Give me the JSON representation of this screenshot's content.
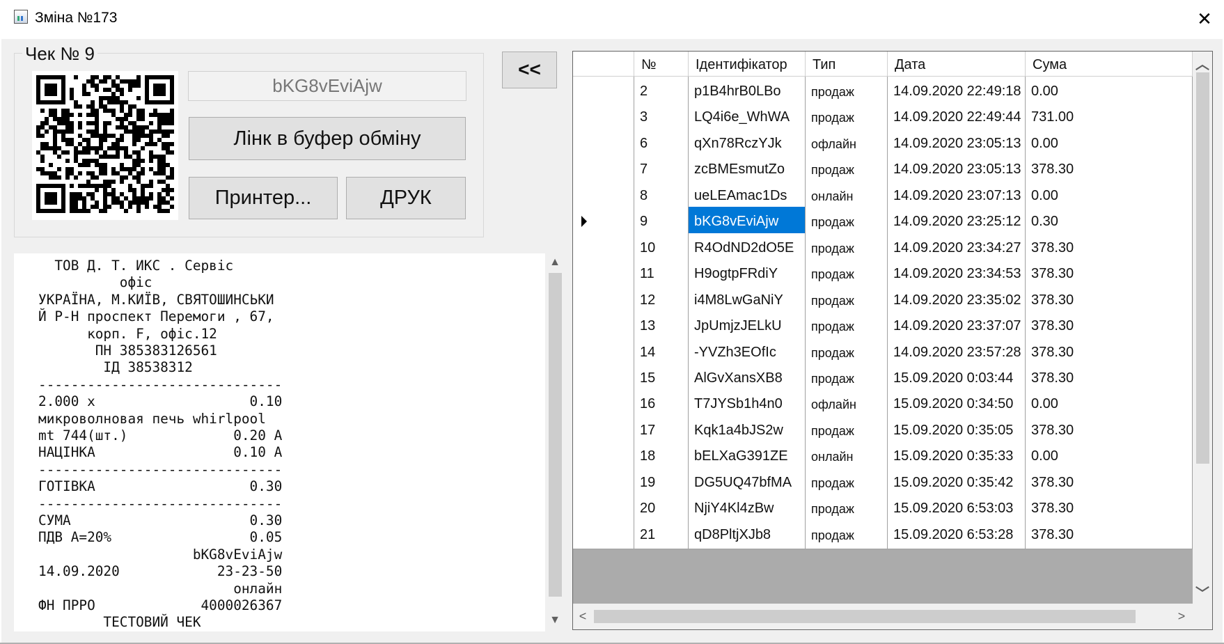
{
  "window": {
    "title": "Зміна №173",
    "close_glyph": "✕",
    "icon": "app-chart-icon"
  },
  "check": {
    "group_title": "Чек № 9",
    "identifier": "bKG8vEviAjw",
    "copy_link_label": "Лінк в буфер обміну",
    "printer_label": "Принтер...",
    "print_label": "ДРУК",
    "back_label": "<<"
  },
  "receipt": {
    "lines": [
      "     ТОВ Д. Т. ИКС . Сервіс",
      "             офіс",
      "   УКРАЇНА, М.КИЇВ, СВЯТОШИНСЬКИ",
      "   Й Р-Н проспект Перемоги , 67,",
      "         корп. F, офіс.12",
      "          ПН 385383126561",
      "           ІД 38538312",
      "   ------------------------------",
      "   2.000 x                   0.10",
      "   микроволновая печь whirlpool",
      "   mt 744(шт.)             0.20 А",
      "   НАЦІНКА                 0.10 А",
      "   ------------------------------",
      "   ГОТІВКА                   0.30",
      "   ------------------------------",
      "   СУМА                      0.30",
      "   ПДВ А=20%                 0.05",
      "                      bKG8vEviAjw",
      "   14.09.2020            23-23-50",
      "                           онлайн",
      "   ФН ПРРО             4000026367",
      "           ТЕСТОВИЙ ЧЕК"
    ],
    "scroll_up": "▲",
    "scroll_down": "▼"
  },
  "grid": {
    "columns": [
      "№",
      "Ідентифікатор",
      "Тип",
      "Дата",
      "Сума"
    ],
    "selected_index": 5,
    "rows": [
      {
        "n": "2",
        "id": "p1B4hrB0LBo",
        "type": "продаж",
        "date": "14.09.2020 22:49:18",
        "sum": "0.00"
      },
      {
        "n": "3",
        "id": "LQ4i6e_WhWA",
        "type": "продаж",
        "date": "14.09.2020 22:49:44",
        "sum": "731.00"
      },
      {
        "n": "6",
        "id": "qXn78RczYJk",
        "type": "офлайн",
        "date": "14.09.2020 23:05:13",
        "sum": "0.00"
      },
      {
        "n": "7",
        "id": "zcBMEsmutZo",
        "type": "продаж",
        "date": "14.09.2020 23:05:13",
        "sum": "378.30"
      },
      {
        "n": "8",
        "id": "ueLEAmac1Ds",
        "type": "онлайн",
        "date": "14.09.2020 23:07:13",
        "sum": "0.00"
      },
      {
        "n": "9",
        "id": "bKG8vEviAjw",
        "type": "продаж",
        "date": "14.09.2020 23:25:12",
        "sum": "0.30"
      },
      {
        "n": "10",
        "id": "R4OdND2dO5E",
        "type": "продаж",
        "date": "14.09.2020 23:34:27",
        "sum": "378.30"
      },
      {
        "n": "11",
        "id": "H9ogtpFRdiY",
        "type": "продаж",
        "date": "14.09.2020 23:34:53",
        "sum": "378.30"
      },
      {
        "n": "12",
        "id": "i4M8LwGaNiY",
        "type": "продаж",
        "date": "14.09.2020 23:35:02",
        "sum": "378.30"
      },
      {
        "n": "13",
        "id": "JpUmjzJELkU",
        "type": "продаж",
        "date": "14.09.2020 23:37:07",
        "sum": "378.30"
      },
      {
        "n": "14",
        "id": "-YVZh3EOfIc",
        "type": "продаж",
        "date": "14.09.2020 23:57:28",
        "sum": "378.30"
      },
      {
        "n": "15",
        "id": "AlGvXansXB8",
        "type": "продаж",
        "date": "15.09.2020 0:03:44",
        "sum": "378.30"
      },
      {
        "n": "16",
        "id": "T7JYSb1h4n0",
        "type": "офлайн",
        "date": "15.09.2020 0:34:50",
        "sum": "0.00"
      },
      {
        "n": "17",
        "id": "Kqk1a4bJS2w",
        "type": "продаж",
        "date": "15.09.2020 0:35:05",
        "sum": "378.30"
      },
      {
        "n": "18",
        "id": "bELXaG391ZE",
        "type": "онлайн",
        "date": "15.09.2020 0:35:33",
        "sum": "0.00"
      },
      {
        "n": "19",
        "id": "DG5UQ47bfMA",
        "type": "продаж",
        "date": "15.09.2020 0:35:42",
        "sum": "378.30"
      },
      {
        "n": "20",
        "id": "NjiY4Kl4zBw",
        "type": "продаж",
        "date": "15.09.2020 6:53:03",
        "sum": "378.30"
      },
      {
        "n": "21",
        "id": "qD8PltjXJb8",
        "type": "продаж",
        "date": "15.09.2020 6:53:28",
        "sum": "378.30"
      }
    ],
    "scroll_up": "︿",
    "scroll_down": "﹀",
    "scroll_left": "<",
    "scroll_right": ">"
  },
  "colors": {
    "selection": "#0078d7",
    "window_bg": "#f0f0f0",
    "button": "#e1e1e1"
  }
}
